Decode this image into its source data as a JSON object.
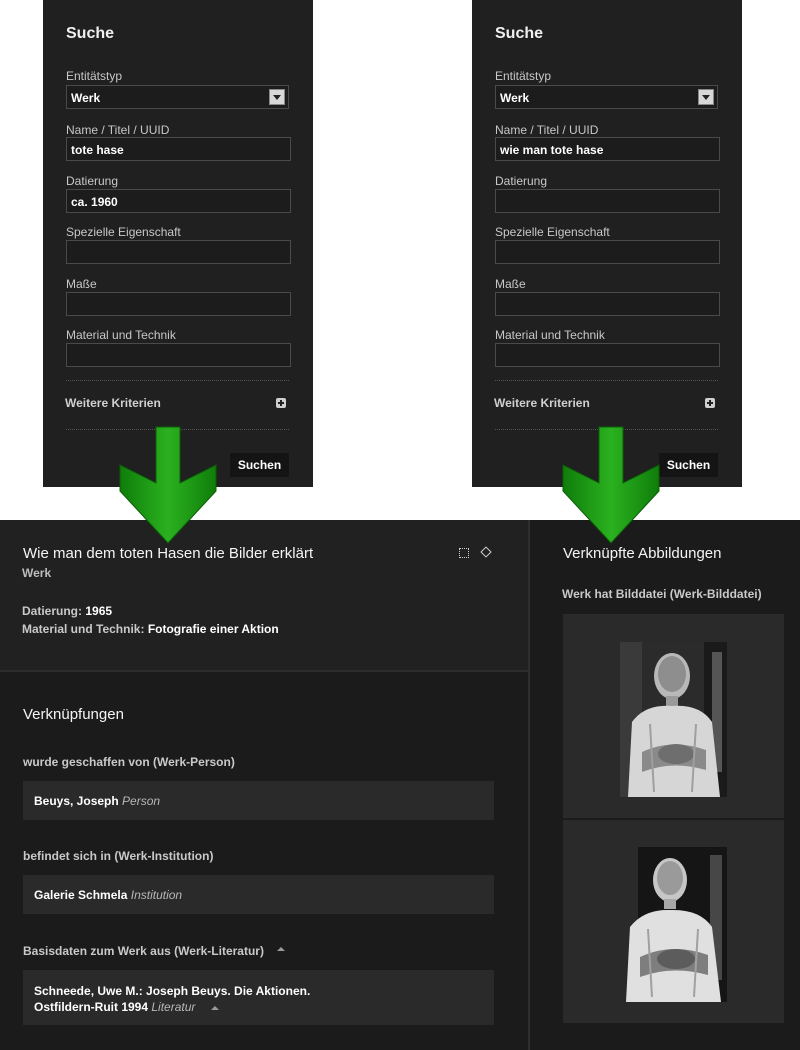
{
  "search_left": {
    "title": "Suche",
    "entity_type_label": "Entitätstyp",
    "entity_type_value": "Werk",
    "name_label": "Name / Titel / UUID",
    "name_value": "tote hase",
    "date_label": "Datierung",
    "date_value": "ca. 1960",
    "special_label": "Spezielle Eigenschaft",
    "special_value": "",
    "size_label": "Maße",
    "size_value": "",
    "material_label": "Material und Technik",
    "material_value": "",
    "more_label": "Weitere Kriterien",
    "search_button": "Suchen"
  },
  "search_right": {
    "title": "Suche",
    "entity_type_label": "Entitätstyp",
    "entity_type_value": "Werk",
    "name_label": "Name / Titel / UUID",
    "name_value": "wie man tote hase",
    "date_label": "Datierung",
    "date_value": "",
    "special_label": "Spezielle Eigenschaft",
    "special_value": "",
    "size_label": "Maße",
    "size_value": "",
    "material_label": "Material und Technik",
    "material_value": "",
    "more_label": "Weitere Kriterien",
    "search_button": "Suchen"
  },
  "detail": {
    "title": "Wie man dem toten Hasen die Bilder erklärt",
    "subtitle": "Werk",
    "date_label": "Datierung:",
    "date_value": "1965",
    "material_label": "Material und Technik:",
    "material_value": "Fotografie einer Aktion"
  },
  "links": {
    "title": "Verknüpfungen",
    "groups": [
      {
        "label": "wurde geschaffen von (Werk-Person)",
        "name": "Beuys, Joseph",
        "type": "Person"
      },
      {
        "label": "befindet sich in (Werk-Institution)",
        "name": "Galerie Schmela",
        "type": "Institution"
      },
      {
        "label": "Basisdaten zum Werk aus (Werk-Literatur)",
        "name_line1": "Schneede, Uwe M.: Joseph Beuys. Die Aktionen.",
        "name_line2": "Ostfildern-Ruit 1994",
        "type": "Literatur"
      }
    ]
  },
  "images": {
    "title": "Verknüpfte Abbildungen",
    "subtitle": "Werk hat Bilddatei (Werk-Bilddatei)"
  },
  "colors": {
    "arrow": "#1c9a12",
    "panel_bg": "#202020",
    "page_bg": "#1b1b1b"
  }
}
